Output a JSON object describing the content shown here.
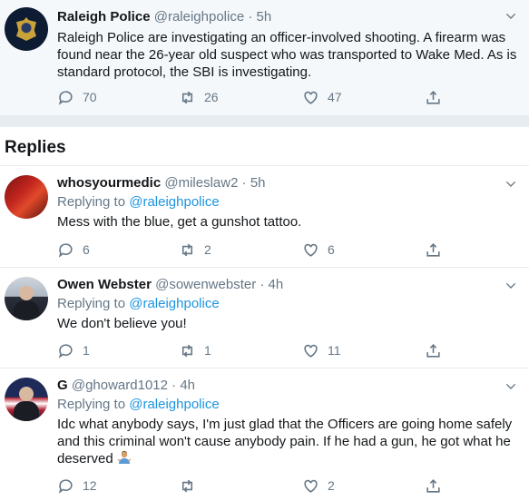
{
  "main_tweet": {
    "author_name": "Raleigh Police",
    "author_handle": "@raleighpolice",
    "time": "5h",
    "text": "Raleigh Police are investigating  an officer-involved shooting. A firearm was found near the 26-year old suspect who was transported to Wake Med. As is standard protocol, the SBI is investigating.",
    "reply_count": "70",
    "retweet_count": "26",
    "like_count": "47"
  },
  "replies_section": {
    "title": "Replies"
  },
  "replies": [
    {
      "author_name": "whosyourmedic",
      "author_handle": "@mileslaw2",
      "time": "5h",
      "replying_prefix": "Replying to",
      "replying_to": "@raleighpolice",
      "text": "Mess with the blue, get a gunshot tattoo.",
      "reply_count": "6",
      "retweet_count": "2",
      "like_count": "6"
    },
    {
      "author_name": "Owen Webster",
      "author_handle": "@sowenwebster",
      "time": "4h",
      "replying_prefix": "Replying to",
      "replying_to": "@raleighpolice",
      "text": "We don't believe you!",
      "reply_count": "1",
      "retweet_count": "1",
      "like_count": "11"
    },
    {
      "author_name": "G",
      "author_handle": "@ghoward1012",
      "time": "4h",
      "replying_prefix": "Replying to",
      "replying_to": "@raleighpolice",
      "text": "Idc what anybody says, I'm just glad that the Officers are going home safely and this criminal won't cause anybody pain. If he had a gun, he got what he deserved",
      "emoji": "person-shrugging-emoji",
      "reply_count": "12",
      "retweet_count": "",
      "like_count": "2"
    }
  ],
  "colors": {
    "link": "#1b95e0",
    "muted": "#657786",
    "text": "#14171a",
    "main_bg": "#f5f8fa"
  }
}
